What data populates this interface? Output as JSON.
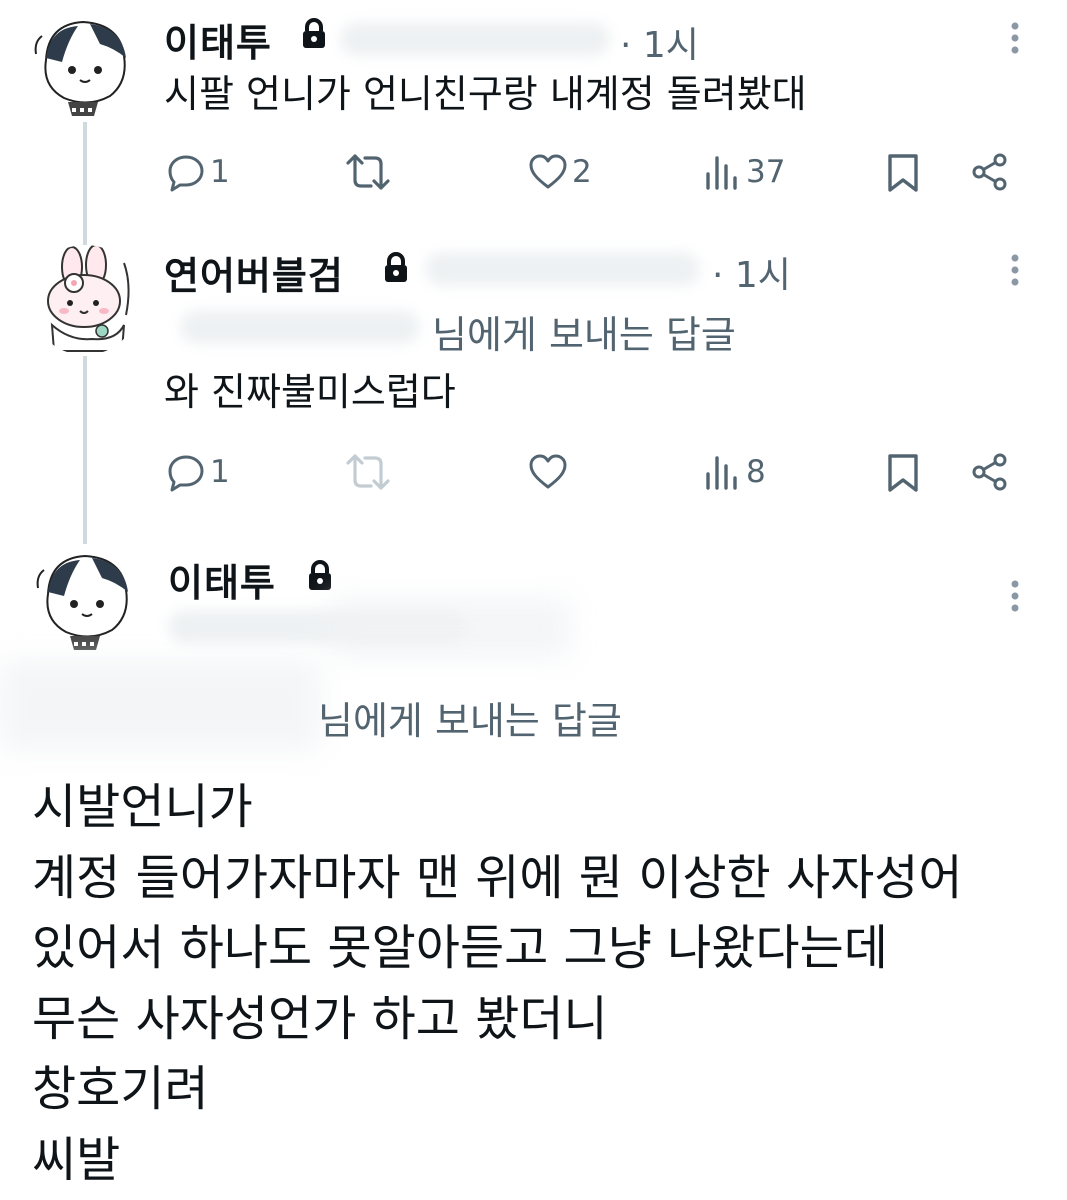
{
  "tweets": [
    {
      "author": "이태투",
      "time": "· 1시",
      "text": "시팔 언니가 언니친구랑 내계정 돌려봤대",
      "replies": "1",
      "likes": "2",
      "views": "37"
    },
    {
      "author": "연어버블검",
      "time": "· 1시",
      "reply_to": "님에게 보내는 답글",
      "text": "와 진짜불미스럽다",
      "replies": "1",
      "likes": "",
      "views": "8"
    },
    {
      "author": "이태투",
      "reply_to": "님에게 보내는 답글",
      "lines": [
        "시발언니가",
        "계정 들어가자마자 맨 위에 뭔 이상한 사자성어",
        "있어서 하나도 못알아듣고 그냥 나왔다는데",
        "무슨 사자성언가 하고 봤더니",
        "창호기려",
        "씨발"
      ]
    }
  ],
  "colors": {
    "text": "#0f1419",
    "muted": "#536471",
    "thread_line": "#cfd9de"
  },
  "icons": [
    "lock-icon",
    "more-icon",
    "reply-icon",
    "retweet-icon",
    "like-icon",
    "views-icon",
    "bookmark-icon",
    "share-icon"
  ]
}
